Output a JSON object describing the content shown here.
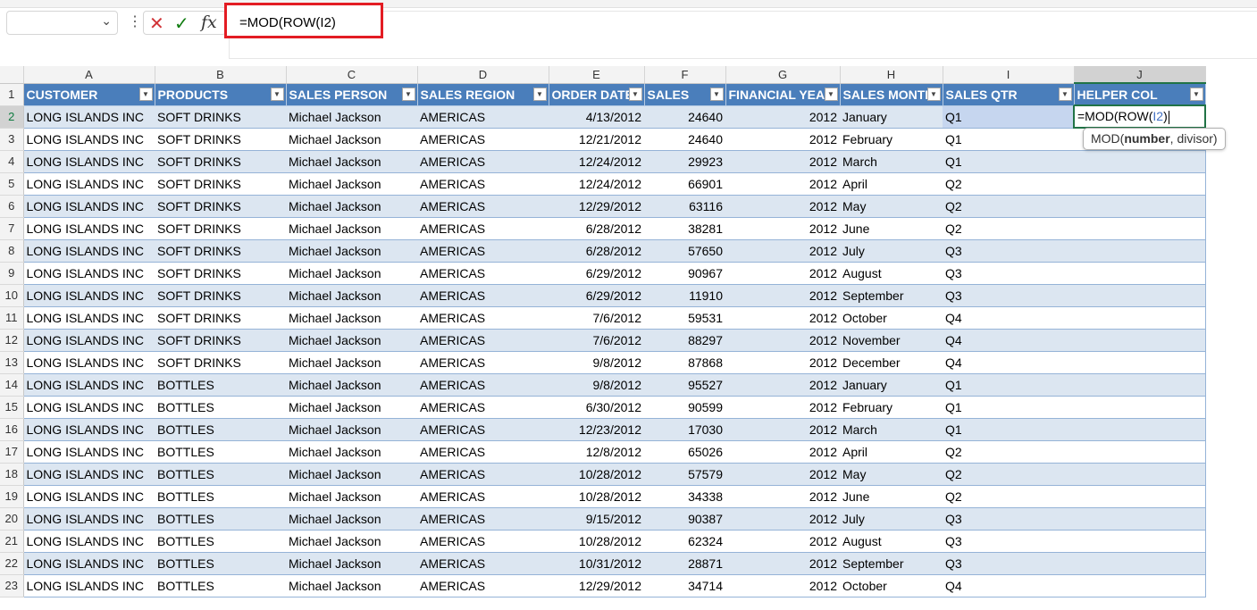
{
  "formula_bar": {
    "name_box": "",
    "formula": "=MOD(ROW(I2)",
    "fx_label": "fx"
  },
  "columns": [
    "A",
    "B",
    "C",
    "D",
    "E",
    "F",
    "G",
    "H",
    "I",
    "J"
  ],
  "headers": [
    "CUSTOMER",
    "PRODUCTS",
    "SALES PERSON",
    "SALES REGION",
    "ORDER DATE",
    "SALES",
    "FINANCIAL YEAR",
    "SALES MONTH",
    "SALES QTR",
    "HELPER COL"
  ],
  "active_cell": {
    "ref": "J2",
    "prefix": "=MOD(ROW(",
    "ref_text": "I2",
    "suffix": ")"
  },
  "tooltip": {
    "func": "MOD(",
    "arg1": "number",
    "rest": ", divisor)"
  },
  "rows": [
    [
      "2",
      "LONG ISLANDS INC",
      "SOFT DRINKS",
      "Michael Jackson",
      "AMERICAS",
      "4/13/2012",
      "24640",
      "2012",
      "January",
      "Q1"
    ],
    [
      "3",
      "LONG ISLANDS INC",
      "SOFT DRINKS",
      "Michael Jackson",
      "AMERICAS",
      "12/21/2012",
      "24640",
      "2012",
      "February",
      "Q1"
    ],
    [
      "4",
      "LONG ISLANDS INC",
      "SOFT DRINKS",
      "Michael Jackson",
      "AMERICAS",
      "12/24/2012",
      "29923",
      "2012",
      "March",
      "Q1"
    ],
    [
      "5",
      "LONG ISLANDS INC",
      "SOFT DRINKS",
      "Michael Jackson",
      "AMERICAS",
      "12/24/2012",
      "66901",
      "2012",
      "April",
      "Q2"
    ],
    [
      "6",
      "LONG ISLANDS INC",
      "SOFT DRINKS",
      "Michael Jackson",
      "AMERICAS",
      "12/29/2012",
      "63116",
      "2012",
      "May",
      "Q2"
    ],
    [
      "7",
      "LONG ISLANDS INC",
      "SOFT DRINKS",
      "Michael Jackson",
      "AMERICAS",
      "6/28/2012",
      "38281",
      "2012",
      "June",
      "Q2"
    ],
    [
      "8",
      "LONG ISLANDS INC",
      "SOFT DRINKS",
      "Michael Jackson",
      "AMERICAS",
      "6/28/2012",
      "57650",
      "2012",
      "July",
      "Q3"
    ],
    [
      "9",
      "LONG ISLANDS INC",
      "SOFT DRINKS",
      "Michael Jackson",
      "AMERICAS",
      "6/29/2012",
      "90967",
      "2012",
      "August",
      "Q3"
    ],
    [
      "10",
      "LONG ISLANDS INC",
      "SOFT DRINKS",
      "Michael Jackson",
      "AMERICAS",
      "6/29/2012",
      "11910",
      "2012",
      "September",
      "Q3"
    ],
    [
      "11",
      "LONG ISLANDS INC",
      "SOFT DRINKS",
      "Michael Jackson",
      "AMERICAS",
      "7/6/2012",
      "59531",
      "2012",
      "October",
      "Q4"
    ],
    [
      "12",
      "LONG ISLANDS INC",
      "SOFT DRINKS",
      "Michael Jackson",
      "AMERICAS",
      "7/6/2012",
      "88297",
      "2012",
      "November",
      "Q4"
    ],
    [
      "13",
      "LONG ISLANDS INC",
      "SOFT DRINKS",
      "Michael Jackson",
      "AMERICAS",
      "9/8/2012",
      "87868",
      "2012",
      "December",
      "Q4"
    ],
    [
      "14",
      "LONG ISLANDS INC",
      "BOTTLES",
      "Michael Jackson",
      "AMERICAS",
      "9/8/2012",
      "95527",
      "2012",
      "January",
      "Q1"
    ],
    [
      "15",
      "LONG ISLANDS INC",
      "BOTTLES",
      "Michael Jackson",
      "AMERICAS",
      "6/30/2012",
      "90599",
      "2012",
      "February",
      "Q1"
    ],
    [
      "16",
      "LONG ISLANDS INC",
      "BOTTLES",
      "Michael Jackson",
      "AMERICAS",
      "12/23/2012",
      "17030",
      "2012",
      "March",
      "Q1"
    ],
    [
      "17",
      "LONG ISLANDS INC",
      "BOTTLES",
      "Michael Jackson",
      "AMERICAS",
      "12/8/2012",
      "65026",
      "2012",
      "April",
      "Q2"
    ],
    [
      "18",
      "LONG ISLANDS INC",
      "BOTTLES",
      "Michael Jackson",
      "AMERICAS",
      "10/28/2012",
      "57579",
      "2012",
      "May",
      "Q2"
    ],
    [
      "19",
      "LONG ISLANDS INC",
      "BOTTLES",
      "Michael Jackson",
      "AMERICAS",
      "10/28/2012",
      "34338",
      "2012",
      "June",
      "Q2"
    ],
    [
      "20",
      "LONG ISLANDS INC",
      "BOTTLES",
      "Michael Jackson",
      "AMERICAS",
      "9/15/2012",
      "90387",
      "2012",
      "July",
      "Q3"
    ],
    [
      "21",
      "LONG ISLANDS INC",
      "BOTTLES",
      "Michael Jackson",
      "AMERICAS",
      "10/28/2012",
      "62324",
      "2012",
      "August",
      "Q3"
    ],
    [
      "22",
      "LONG ISLANDS INC",
      "BOTTLES",
      "Michael Jackson",
      "AMERICAS",
      "10/31/2012",
      "28871",
      "2012",
      "September",
      "Q3"
    ],
    [
      "23",
      "LONG ISLANDS INC",
      "BOTTLES",
      "Michael Jackson",
      "AMERICAS",
      "12/29/2012",
      "34714",
      "2012",
      "October",
      "Q4"
    ]
  ]
}
